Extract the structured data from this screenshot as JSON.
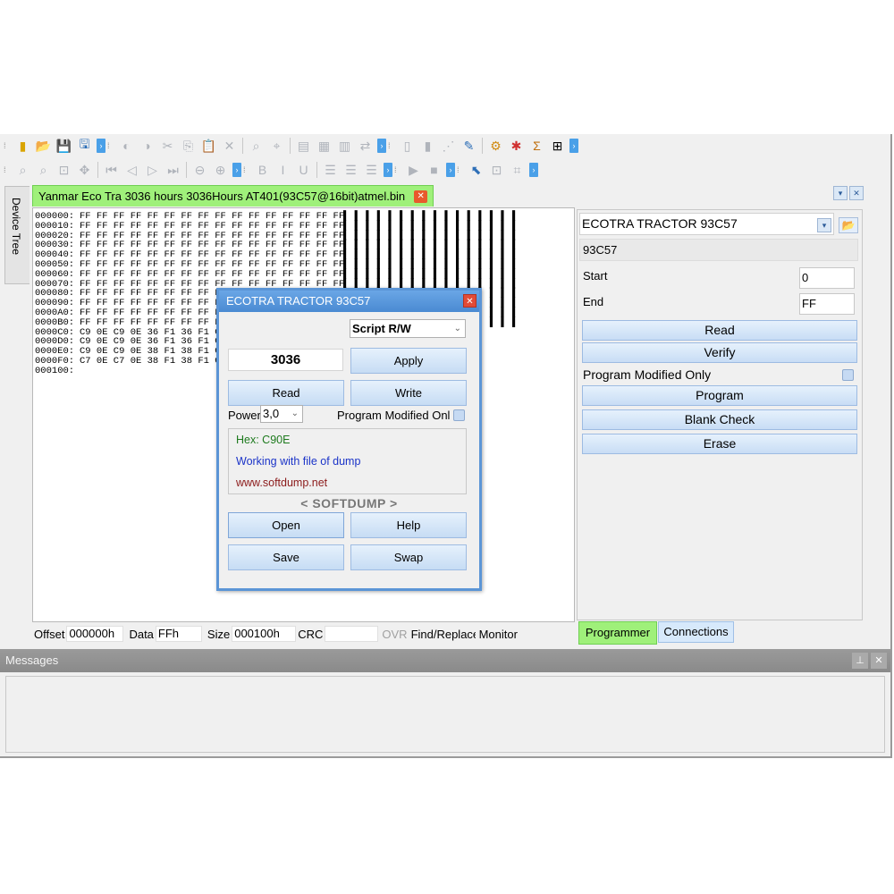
{
  "document_tab": {
    "title": "Yanmar Eco Tra 3036 hours 3036Hours AT401(93C57@16bit)atmel.bin"
  },
  "side_tab": {
    "label": "Device Tree"
  },
  "hex_editor": {
    "rows": [
      {
        "offset": "000000:",
        "bytes": "FF FF FF FF FF FF FF FF FF FF FF FF FF FF FF FF",
        "ascii": "█ █ █ █ █ █ █ █ █ █ █ █ █ █ █ █"
      },
      {
        "offset": "000010:",
        "bytes": "FF FF FF FF FF FF FF FF FF FF FF FF FF FF FF FF",
        "ascii": "█ █ █ █ █ █ █ █ █ █ █ █ █ █ █ █"
      },
      {
        "offset": "000020:",
        "bytes": "FF FF FF FF FF FF FF FF FF FF FF FF FF FF FF FF",
        "ascii": "█ █ █ █ █ █ █ █ █ █ █ █ █ █ █ █"
      },
      {
        "offset": "000030:",
        "bytes": "FF FF FF FF FF FF FF FF FF FF FF FF FF FF FF FF",
        "ascii": "█ █ █ █ █ █ █ █ █ █ █ █ █ █ █ █"
      },
      {
        "offset": "000040:",
        "bytes": "FF FF FF FF FF FF FF FF FF FF FF FF FF FF FF FF",
        "ascii": "█ █ █ █ █ █ █ █ █ █ █ █ █ █ █ █"
      },
      {
        "offset": "000050:",
        "bytes": "FF FF FF FF FF FF FF FF FF FF FF FF FF FF FF FF",
        "ascii": "█ █ █ █ █ █ █ █ █ █ █ █ █ █ █ █"
      },
      {
        "offset": "000060:",
        "bytes": "FF FF FF FF FF FF FF FF FF FF FF FF FF FF FF FF",
        "ascii": "█ █ █ █ █ █ █ █ █ █ █ █ █ █ █ █"
      },
      {
        "offset": "000070:",
        "bytes": "FF FF FF FF FF FF FF FF FF FF FF FF FF FF FF FF",
        "ascii": "█ █ █ █ █ █ █ █ █ █ █ █ █ █ █ █"
      },
      {
        "offset": "000080:",
        "bytes": "FF FF FF FF FF FF FF FF FF FF FF FF FF FF FF FF",
        "ascii": "█ █ █ █ █ █ █ █ █ █ █ █ █ █ █ █"
      },
      {
        "offset": "000090:",
        "bytes": "FF FF FF FF FF FF FF FF FF FF FF FF FF FF FF FF",
        "ascii": "█ █ █ █ █ █ █ █ █ █ █ █ █ █ █ █"
      },
      {
        "offset": "0000A0:",
        "bytes": "FF FF FF FF FF FF FF FF FF FF FF FF FF FF FF FF",
        "ascii": "█ █ █ █ █ █ █ █ █ █ █ █ █ █ █ █"
      },
      {
        "offset": "0000B0:",
        "bytes": "FF FF FF FF FF FF FF FF FF FF FF FF FF FF FF FF",
        "ascii": "█ █ █ █ █ █ █ █ █ █ █ █ █ █ █ █"
      },
      {
        "offset": "0000C0:",
        "bytes": "C9 0E C9 0E 36 F1 36 F1 C9 0E C9 0E 36 F1 36 F1",
        "ascii": "  6 █"
      },
      {
        "offset": "0000D0:",
        "bytes": "C9 0E C9 0E 36 F1 36 F1 C9 0E C9 0E 36 F1 36 F1",
        "ascii": "  6 █"
      },
      {
        "offset": "0000E0:",
        "bytes": "C9 0E C9 0E 38 F1 38 F1 C9 0E C9 0E 38 F1 38 F1",
        "ascii": "  8 █"
      },
      {
        "offset": "0000F0:",
        "bytes": "C7 0E C7 0E 38 F1 38 F1 C7 0E C7 0E 39 F1 39 F1",
        "ascii": "  9 █"
      },
      {
        "offset": "000100:",
        "bytes": "",
        "ascii": ""
      }
    ]
  },
  "status_bar": {
    "offset_label": "Offset",
    "offset_value": "000000h",
    "data_label": "Data",
    "data_value": "FFh",
    "size_label": "Size",
    "size_value": "000100h",
    "crc_label": "CRC",
    "crc_value": "",
    "ovr_label": "OVR",
    "find_label": "Find/Replace",
    "monitor_label": "Monitor"
  },
  "programmer": {
    "chip_select": "ECOTRA TRACTOR 93C57",
    "chip_name": "93C57",
    "start_label": "Start",
    "start_value": "0",
    "end_label": "End",
    "end_value": "FF",
    "read_button": "Read",
    "verify_button": "Verify",
    "program_modified_only": "Program Modified Only",
    "program_button": "Program",
    "blank_check_button": "Blank Check",
    "erase_button": "Erase"
  },
  "bottom_tabs": {
    "programmer": "Programmer",
    "connections": "Connections"
  },
  "messages": {
    "title": "Messages"
  },
  "dialog": {
    "title": "ECOTRA TRACTOR 93C57",
    "script_select": "Script R/W",
    "hours_value": "3036",
    "apply_button": "Apply",
    "read_button": "Read",
    "write_button": "Write",
    "power_label": "Power",
    "power_value": "3,0",
    "program_modified_only": "Program Modified Only",
    "info_hex": "Hex: C90E",
    "info_working": "Working with file of dump",
    "info_site": "www.softdump.net",
    "brand": "< SOFTDUMP >",
    "open_button": "Open",
    "help_button": "Help",
    "save_button": "Save",
    "swap_button": "Swap"
  },
  "colors": {
    "tab_active": "#9ff07a",
    "button_gradient_top": "#e6f1fc",
    "button_gradient_bottom": "#c6dcf4",
    "dialog_title": "#4a8ad2",
    "info_hex": "#1d7a1d",
    "info_working": "#1a33c8",
    "info_site": "#8b1a1a"
  }
}
